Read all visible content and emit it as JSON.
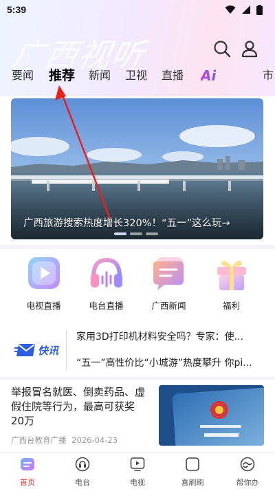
{
  "status_bar": {
    "time": "5:39"
  },
  "header": {
    "brand": "广西视听",
    "tabs": [
      {
        "label": "要闻",
        "active": false
      },
      {
        "label": "推荐",
        "active": true
      },
      {
        "label": "新闻",
        "active": false
      },
      {
        "label": "卫视",
        "active": false
      },
      {
        "label": "直播",
        "active": false
      },
      {
        "label": "Ai",
        "active": false
      },
      {
        "label": "市",
        "active": false
      }
    ]
  },
  "banner": {
    "caption": "广西旅游搜索热度增长320%！“五一”这么玩→",
    "dots": 3,
    "active_dot": 0
  },
  "quick_links": [
    {
      "label": "电视直播",
      "icon": "tv-play-icon"
    },
    {
      "label": "电台直播",
      "icon": "headphones-icon"
    },
    {
      "label": "广西新闻",
      "icon": "news-chat-icon"
    },
    {
      "label": "福利",
      "icon": "gift-icon"
    }
  ],
  "flash_news": {
    "logo": "快讯",
    "items": [
      "家用3D打印机材料安全吗？专家：使...",
      "“五一”高性价比“小城游”热度攀升 你pi..."
    ]
  },
  "article": {
    "title": "举报冒名就医、倒卖药品、虚假住院等行为，最高可获奖20万",
    "source": "广西台教育广播",
    "date": "2026-04-23"
  },
  "bottom_nav": [
    {
      "label": "首页",
      "icon": "home-icon",
      "active": true
    },
    {
      "label": "电台",
      "icon": "radio-icon",
      "active": false
    },
    {
      "label": "电视",
      "icon": "tv-icon",
      "active": false
    },
    {
      "label": "喜刷刷",
      "icon": "video-feed-icon",
      "active": false
    },
    {
      "label": "帮你办",
      "icon": "service-icon",
      "active": false
    }
  ],
  "colors": {
    "accent": "#e5352b",
    "arrow": "#e8201c"
  }
}
